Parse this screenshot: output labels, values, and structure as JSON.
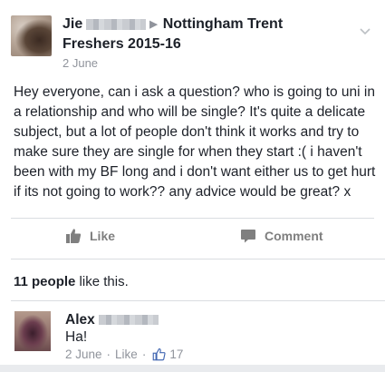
{
  "post": {
    "author_first": "Jie",
    "group": "Nottingham Trent",
    "group_line2": "Freshers 2015-16",
    "date": "2 June",
    "text": "Hey everyone, can i ask a question? who is going to uni in a relationship and who will be single? It's quite a delicate subject, but a lot of people don't think it works and try to make sure they are single for when they start :( i haven't been with my BF long and i don't want either us to get hurt if its not going to work?? any advice would be great? x"
  },
  "actions": {
    "like_label": "Like",
    "comment_label": "Comment"
  },
  "likes": {
    "count_label": "11 people",
    "suffix": "like this."
  },
  "comment": {
    "author_first": "Alex",
    "text": "Ha!",
    "date": "2 June",
    "like_label": "Like",
    "like_count": "17"
  },
  "colors": {
    "text": "#1d2129",
    "muted": "#90949c",
    "action": "#7f7f7f",
    "link_blue": "#4267b2"
  },
  "icons": {
    "chevron": "chevron-down-icon",
    "like": "thumbs-up-icon",
    "comment": "speech-bubble-icon"
  }
}
